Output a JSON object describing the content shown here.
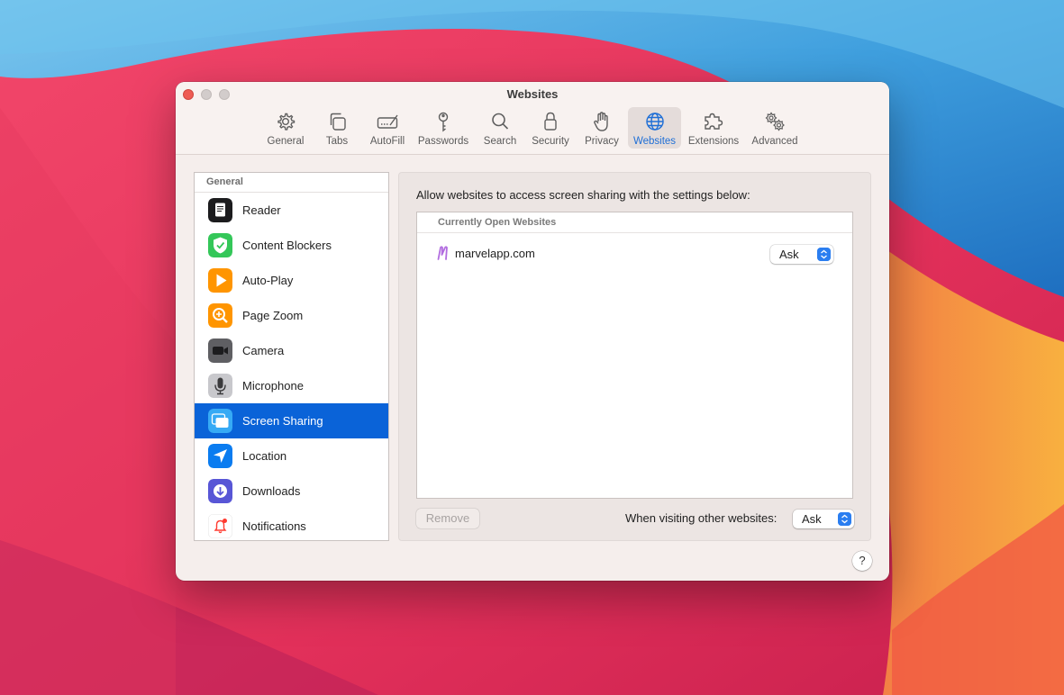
{
  "window": {
    "title": "Websites"
  },
  "toolbar": {
    "items": [
      {
        "label": "General",
        "icon": "gear-icon"
      },
      {
        "label": "Tabs",
        "icon": "tabs-icon"
      },
      {
        "label": "AutoFill",
        "icon": "autofill-icon"
      },
      {
        "label": "Passwords",
        "icon": "key-icon"
      },
      {
        "label": "Search",
        "icon": "search-icon"
      },
      {
        "label": "Security",
        "icon": "lock-icon"
      },
      {
        "label": "Privacy",
        "icon": "hand-icon"
      },
      {
        "label": "Websites",
        "icon": "globe-icon",
        "active": true
      },
      {
        "label": "Extensions",
        "icon": "puzzle-icon"
      },
      {
        "label": "Advanced",
        "icon": "gears-icon"
      }
    ]
  },
  "sidebar": {
    "header": "General",
    "items": [
      {
        "label": "Reader",
        "color": "#1c1c1e"
      },
      {
        "label": "Content Blockers",
        "color": "#34c759"
      },
      {
        "label": "Auto-Play",
        "color": "#ff9500"
      },
      {
        "label": "Page Zoom",
        "color": "#ff9500"
      },
      {
        "label": "Camera",
        "color": "#5f5f63"
      },
      {
        "label": "Microphone",
        "color": "#b8b8bc"
      },
      {
        "label": "Screen Sharing",
        "color": "#36aaf5",
        "selected": true
      },
      {
        "label": "Location",
        "color": "#0a7cf0"
      },
      {
        "label": "Downloads",
        "color": "#5856d6"
      },
      {
        "label": "Notifications",
        "color": "#ffffff"
      }
    ]
  },
  "panel": {
    "description": "Allow websites to access screen sharing with the settings below:",
    "table_header": "Currently Open Websites",
    "sites": [
      {
        "name": "marvelapp.com",
        "setting": "Ask"
      }
    ],
    "remove_label": "Remove",
    "other_label": "When visiting other websites:",
    "other_value": "Ask"
  },
  "help_label": "?"
}
